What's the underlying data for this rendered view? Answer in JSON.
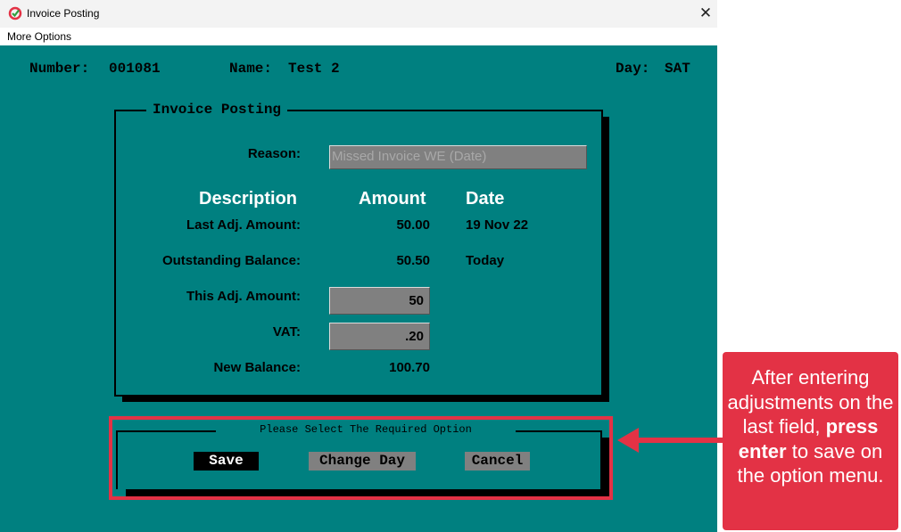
{
  "window": {
    "title": "Invoice Posting",
    "menu": {
      "more_options": "More Options"
    }
  },
  "header": {
    "number_label": "Number:",
    "number_value": "001081",
    "name_label": "Name:",
    "name_value": "Test 2",
    "day_label": "Day:",
    "day_value": "SAT"
  },
  "panel": {
    "title": "Invoice Posting",
    "reason_label": "Reason:",
    "reason_placeholder": "Missed Invoice WE (Date)",
    "columns": {
      "description": "Description",
      "amount": "Amount",
      "date": "Date"
    },
    "rows": {
      "last_adj": {
        "label": "Last Adj. Amount:",
        "amount": "50.00",
        "date": "19 Nov 22"
      },
      "outstanding": {
        "label": "Outstanding Balance:",
        "amount": "50.50",
        "date": "Today"
      },
      "this_adj": {
        "label": "This Adj. Amount:",
        "value": "50"
      },
      "vat": {
        "label": "VAT:",
        "value": ".20"
      },
      "new_balance": {
        "label": "New Balance:",
        "amount": "100.70"
      }
    }
  },
  "options": {
    "title": "Please Select The Required Option",
    "save": "Save",
    "change_day": "Change Day",
    "cancel": "Cancel"
  },
  "callout": {
    "text_before": "After entering adjustments on the last field,",
    "text_bold": "press enter",
    "text_after": "to save on the option menu."
  },
  "colors": {
    "background": "#008080",
    "annotation": "#e33245"
  }
}
